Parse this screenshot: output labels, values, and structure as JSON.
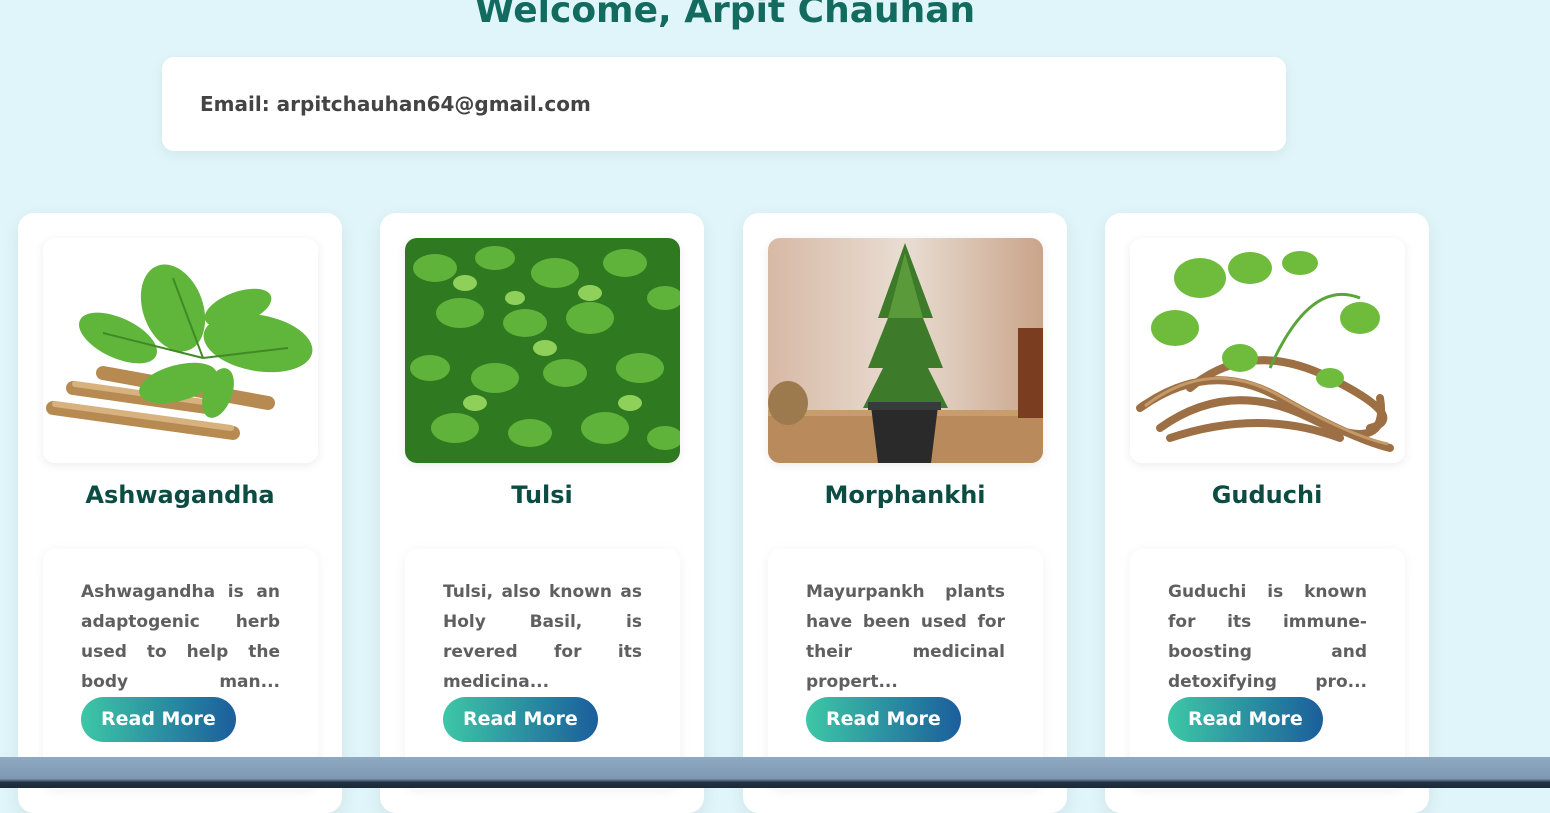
{
  "header": {
    "welcome": "Welcome, Arpit Chauhan"
  },
  "profile": {
    "email": "Email: arpitchauhan64@gmail.com"
  },
  "cards": [
    {
      "title": "Ashwagandha",
      "description": "Ashwagandha is an adaptogenic herb used to help the body man...",
      "button": "Read More",
      "image_icon": "ashwagandha-image"
    },
    {
      "title": "Tulsi",
      "description": "Tulsi, also known as Holy Basil, is revered for its medicina...",
      "button": "Read More",
      "image_icon": "tulsi-image"
    },
    {
      "title": "Morphankhi",
      "description": "Mayurpankh plants have been used for their medicinal propert...",
      "button": "Read More",
      "image_icon": "morphankhi-image"
    },
    {
      "title": "Guduchi",
      "description": "Guduchi is known for its immune-boosting and detoxifying pro...",
      "button": "Read More",
      "image_icon": "guduchi-image"
    }
  ],
  "colors": {
    "background": "#e0f5f9",
    "heading": "#136b60",
    "button_start": "#3dc7a6",
    "button_end": "#1b5e9c"
  }
}
